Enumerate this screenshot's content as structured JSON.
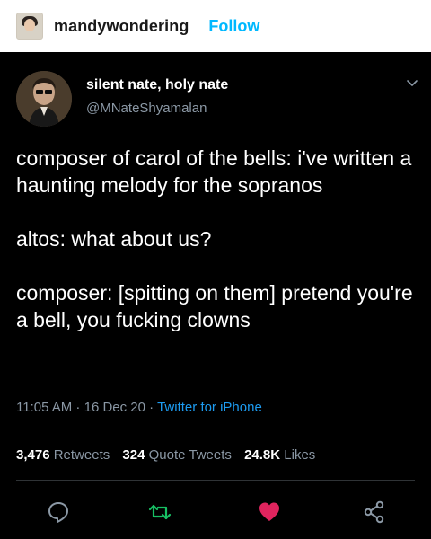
{
  "post": {
    "username": "mandywondering",
    "follow_label": "Follow"
  },
  "tweet": {
    "display_name": "silent nate, holy nate",
    "handle": "@MNateShyamalan",
    "paragraphs": [
      "composer of carol of the bells: i've written a haunting melody for the sopranos",
      "altos: what about us?",
      "composer: [spitting on them] pretend you're a bell, you fucking clowns"
    ],
    "time": "11:05 AM",
    "date": "16 Dec 20",
    "source": "Twitter for iPhone",
    "separator": " · ",
    "stats": {
      "retweets_count": "3,476",
      "retweets_label": "Retweets",
      "quotes_count": "324",
      "quotes_label": "Quote Tweets",
      "likes_count": "24.8K",
      "likes_label": "Likes"
    },
    "icons": {
      "reply": "reply-icon",
      "retweet": "retweet-icon",
      "like": "heart-icon",
      "share": "share-icon",
      "menu": "chevron-down-icon"
    }
  },
  "colors": {
    "follow": "#00b8ff",
    "retweet": "#17bf63",
    "like": "#e0245e",
    "link": "#1d9bf0",
    "muted": "#8b98a5"
  }
}
